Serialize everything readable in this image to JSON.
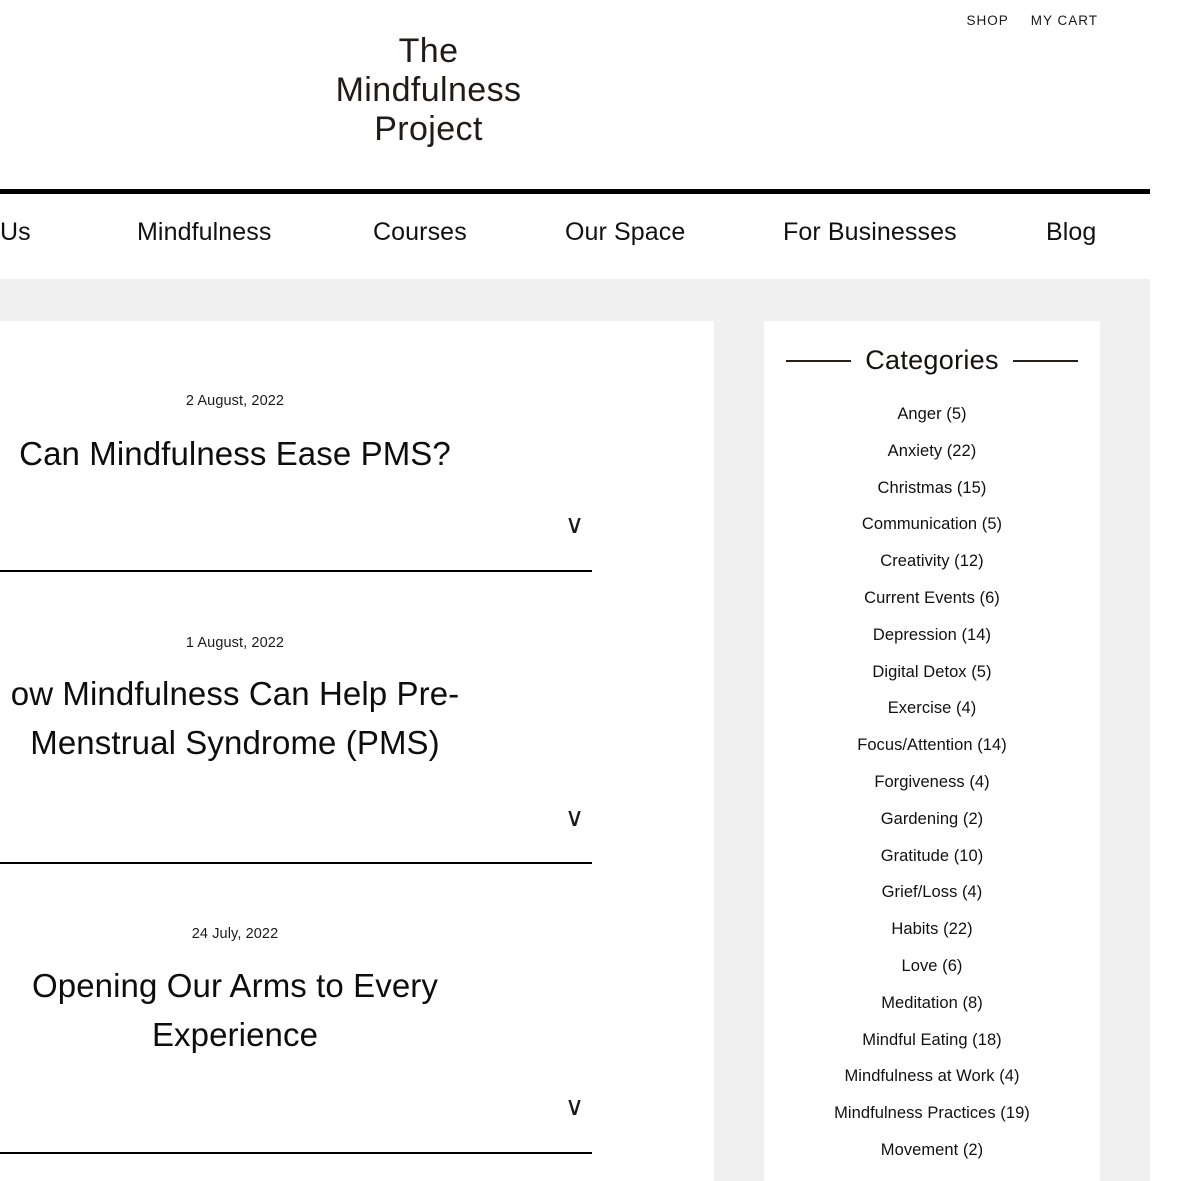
{
  "utility": {
    "links": [
      {
        "label": "SHOP"
      },
      {
        "label": "MY CART"
      }
    ]
  },
  "logo": {
    "line1": "The",
    "line2": "Mindfulness",
    "line3": "Project",
    "full": "The Mindfulness Project"
  },
  "nav": {
    "items": [
      {
        "label": "Us"
      },
      {
        "label": "Mindfulness"
      },
      {
        "label": "Courses"
      },
      {
        "label": "Our Space"
      },
      {
        "label": "For Businesses"
      },
      {
        "label": "Blog"
      }
    ]
  },
  "posts": [
    {
      "date": "2 August, 2022",
      "title": "Can Mindfulness Ease PMS?",
      "expand_icon": "chevron-down"
    },
    {
      "date": "1 August, 2022",
      "title": "ow Mindfulness Can Help Pre-Menstrual Syndrome (PMS)",
      "expand_icon": "chevron-down"
    },
    {
      "date": "24 July, 2022",
      "title": "Opening Our Arms to Every Experience",
      "expand_icon": "chevron-down"
    }
  ],
  "sidebar": {
    "title": "Categories",
    "categories": [
      {
        "label": "Anger (5)"
      },
      {
        "label": "Anxiety (22)"
      },
      {
        "label": "Christmas (15)"
      },
      {
        "label": "Communication (5)"
      },
      {
        "label": "Creativity (12)"
      },
      {
        "label": "Current Events (6)"
      },
      {
        "label": "Depression (14)"
      },
      {
        "label": "Digital Detox (5)"
      },
      {
        "label": "Exercise (4)"
      },
      {
        "label": "Focus/Attention (14)"
      },
      {
        "label": "Forgiveness (4)"
      },
      {
        "label": "Gardening (2)"
      },
      {
        "label": "Gratitude (10)"
      },
      {
        "label": "Grief/Loss (4)"
      },
      {
        "label": "Habits (22)"
      },
      {
        "label": "Love (6)"
      },
      {
        "label": "Meditation (8)"
      },
      {
        "label": "Mindful Eating (18)"
      },
      {
        "label": "Mindfulness at Work (4)"
      },
      {
        "label": "Mindfulness Practices (19)"
      },
      {
        "label": "Movement (2)"
      }
    ]
  },
  "icons": {
    "chevron_down": "∨"
  },
  "colors": {
    "page_background": "#ffffff",
    "body_background": "#f0f0f0",
    "card_background": "#ffffff",
    "text": "#111111",
    "rule": "#000000"
  }
}
